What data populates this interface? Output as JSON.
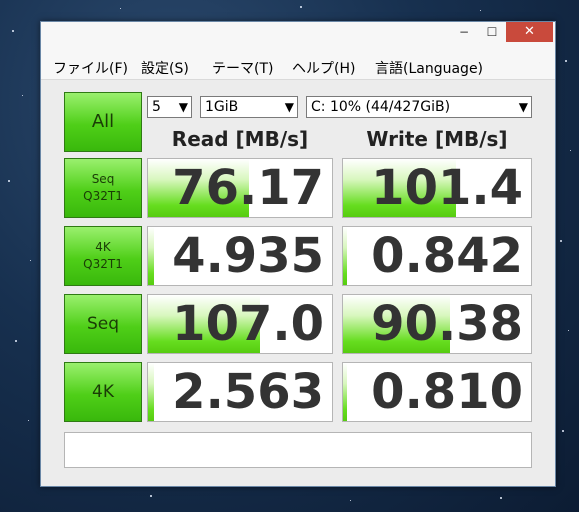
{
  "window": {
    "controls": {
      "minimize": "−",
      "maximize": "☐",
      "close": "✕"
    }
  },
  "menu": [
    "ファイル(F)",
    "設定(S)",
    "テーマ(T)",
    "ヘルプ(H)",
    "言語(Language)"
  ],
  "controls": {
    "all_label": "All",
    "count": "5",
    "size": "1GiB",
    "drive": "C: 10% (44/427GiB)"
  },
  "headers": {
    "read": "Read [MB/s]",
    "write": "Write [MB/s]"
  },
  "tests": [
    {
      "label": "Seq\nQ32T1",
      "read": "76.17",
      "write": "101.4",
      "read_fill": 0.55,
      "write_fill": 0.6
    },
    {
      "label": "4K\nQ32T1",
      "read": "4.935",
      "write": "0.842",
      "read_fill": 0.03,
      "write_fill": 0.02
    },
    {
      "label": "Seq",
      "read": "107.0",
      "write": "90.38",
      "read_fill": 0.61,
      "write_fill": 0.57
    },
    {
      "label": "4K",
      "read": "2.563",
      "write": "0.810",
      "read_fill": 0.03,
      "write_fill": 0.02
    }
  ],
  "status_text": "",
  "colors": {
    "button_green": "#4fcf18",
    "bar_green": "#66dd1f",
    "close_red": "#c94a3c"
  }
}
